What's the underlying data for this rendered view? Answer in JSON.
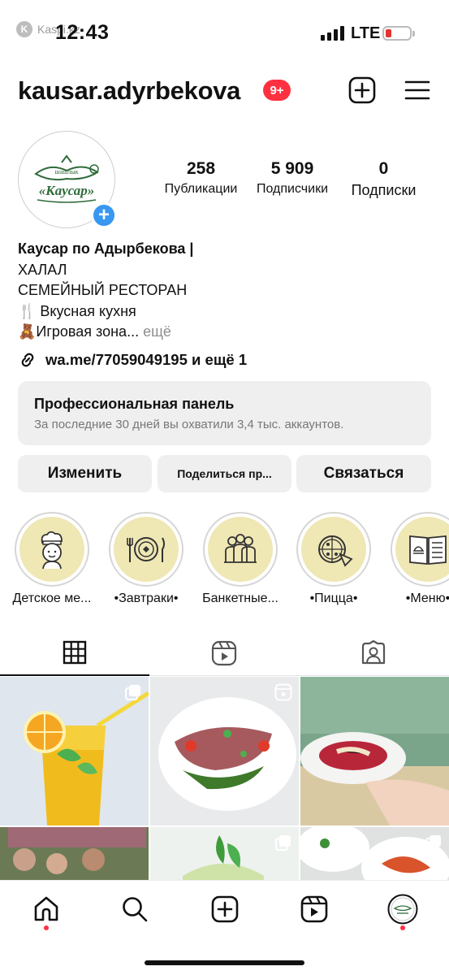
{
  "status_bar": {
    "time": "12:43",
    "network": "LTE",
    "watermark": "Kaspi.kz",
    "watermark_logo": "K"
  },
  "header": {
    "username": "kausar.adyrbekova",
    "notifications_badge": "9+",
    "icons": [
      "plus-square-icon",
      "hamburger-menu-icon"
    ]
  },
  "profile": {
    "avatar_logo_text": "«Каусар»",
    "avatar_logo_top": "шашлык",
    "add_story": "+",
    "stats": [
      {
        "value": "258",
        "label": "Публикации"
      },
      {
        "value": "5 909",
        "label": "Подписчики"
      },
      {
        "value": "0",
        "label": "Подписки"
      }
    ],
    "bio": {
      "name": "Каусар по Адырбекова |",
      "line1": "ХАЛАЛ",
      "line2": "СЕМЕЙНЫЙ РЕСТОРАН",
      "line3": "🍴 Вкусная кухня",
      "line4": "🧸Игровая зона...",
      "more": " ещё"
    },
    "link": "wa.me/77059049195 и ещё 1"
  },
  "pro_panel": {
    "title": "Профессиональная панель",
    "subtitle": "За последние 30 дней вы охватили 3,4 тыс. аккаунтов."
  },
  "buttons": {
    "edit": "Изменить",
    "share": "Поделиться пр...",
    "contact": "Связаться"
  },
  "highlights": [
    {
      "label": "Детское ме...",
      "icon": "chef-kid-icon"
    },
    {
      "label": "•Завтраки•",
      "icon": "plate-cutlery-icon"
    },
    {
      "label": "Банкетные...",
      "icon": "group-people-icon"
    },
    {
      "label": "•Пицца•",
      "icon": "pizza-icon"
    },
    {
      "label": "•Меню•",
      "icon": "menu-book-icon"
    }
  ],
  "tabs": [
    "grid-icon",
    "reels-icon",
    "tagged-icon"
  ],
  "posts": [
    {
      "desc": "lemonade",
      "badge": "multi-post-icon"
    },
    {
      "desc": "meat salad",
      "badge": "reels-icon"
    },
    {
      "desc": "soup bowl",
      "badge": ""
    },
    {
      "desc": "event photo",
      "badge": ""
    },
    {
      "desc": "mint drink",
      "badge": "multi-post-icon"
    },
    {
      "desc": "dish",
      "badge": "multi-post-icon"
    }
  ],
  "bottom_nav": [
    "home-icon",
    "search-icon",
    "create-icon",
    "reels-icon",
    "profile-avatar-icon"
  ],
  "colors": {
    "accent_blue": "#3897f0",
    "badge_red": "#ff3040",
    "highlight_bg": "#efe7b4",
    "panel_bg": "#efefef"
  }
}
